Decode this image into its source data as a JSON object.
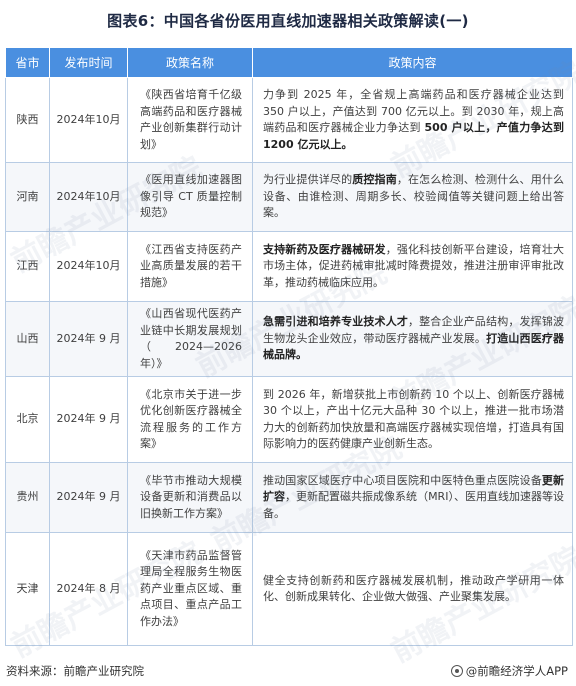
{
  "title": "图表6：中国各省份医用直线加速器相关政策解读(一)",
  "headers": [
    "省市",
    "发布时间",
    "政策名称",
    "政策内容"
  ],
  "rows": [
    {
      "province": "陕西",
      "date": "2024年10月",
      "name": "《陕西省培育千亿级高端药品和医疗器械产业创新集群行动计划》",
      "content_plain": "力争到 2025 年，全省规上高端药品和医疗器械企业达到 350 户以上，产值达到 700 亿元以上。到 2030 年，规上高端药品和医疗器械企业力争达到 ",
      "content_bold": "500 户以上，产值力争达到 1200 亿元以上。"
    },
    {
      "province": "河南",
      "date": "2024年10月",
      "name": "《医用直线加速器图像引导 CT 质量控制规范》",
      "content_plain": "为行业提供详尽的",
      "content_bold": "质控指南",
      "content_rest": "，在怎么检测、检测什么、用什么设备、由谁检测、周期多长、校验阈值等关键问题上给出答案。"
    },
    {
      "province": "江西",
      "date": "2024年10月",
      "name": "《江西省支持医药产业高质量发展的若干措施》",
      "content_bold": "支持新药及医疗器械研发",
      "content_rest": "，强化科技创新平台建设，培育壮大市场主体，促进药械审批减时降费提效，推进注册审评审批改革，推动药械临床应用。"
    },
    {
      "province": "山西",
      "date": "2024年 9 月",
      "name": "《山西省现代医药产业链中长期发展规划（2024—2026 年）》",
      "content_bold": "急需引进和培养专业技术人才",
      "content_rest": "，整合企业产品结构，发挥锦波生物龙头企业效应，带动医疗器械产业发展。",
      "content_bold2": "打造山西医疗器械品牌。"
    },
    {
      "province": "北京",
      "date": "2024年 9 月",
      "name": "《北京市关于进一步优化创新医疗器械全流程服务的工作方案》",
      "content_plain": "到 2026 年，新增获批上市创新药 10 个以上、创新医疗器械 30 个以上，产出十亿元大品种 30 个以上，推进一批市场潜力大的创新药加快放量和高端医疗器械实现倍增，打造具有国际影响力的医药健康产业创新生态。"
    },
    {
      "province": "贵州",
      "date": "2024年 9 月",
      "name": "《毕节市推动大规模设备更新和消费品以旧换新工作方案》",
      "content_plain": "推动国家区域医疗中心项目医院和中医特色重点医院设备",
      "content_bold": "更新扩容",
      "content_rest": "，更新配置磁共振成像系统（MRI）、医用直线加速器等设备。"
    },
    {
      "province": "天津",
      "date": "2024年 8 月",
      "name": "《天津市药品监督管理局全程服务生物医药产业重点区域、重点项目、重点产品工作办法》",
      "content_plain": "健全支持创新药和医疗器械发展机制，推动政产学研用一体化、创新成果转化、企业做大做强、产业聚集发展。"
    }
  ],
  "footer": {
    "source": "资料来源：前瞻产业研究院",
    "brand": "@前瞻经济学人APP"
  },
  "watermark_text": "前瞻产业研究院"
}
